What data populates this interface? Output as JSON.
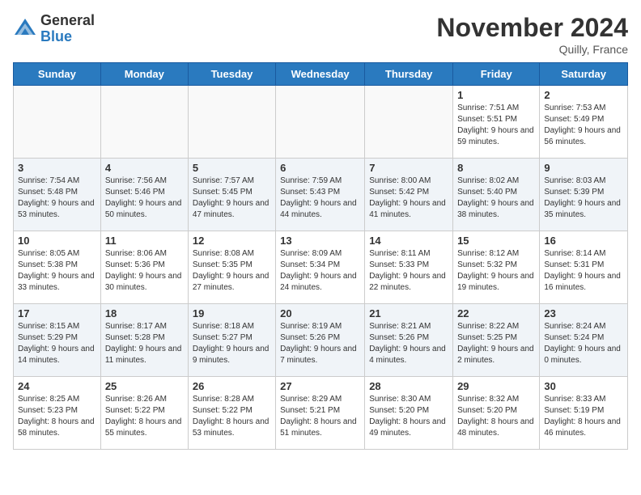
{
  "logo": {
    "general": "General",
    "blue": "Blue"
  },
  "header": {
    "month": "November 2024",
    "location": "Quilly, France"
  },
  "weekdays": [
    "Sunday",
    "Monday",
    "Tuesday",
    "Wednesday",
    "Thursday",
    "Friday",
    "Saturday"
  ],
  "weeks": [
    [
      {
        "day": null,
        "info": ""
      },
      {
        "day": null,
        "info": ""
      },
      {
        "day": null,
        "info": ""
      },
      {
        "day": null,
        "info": ""
      },
      {
        "day": null,
        "info": ""
      },
      {
        "day": "1",
        "info": "Sunrise: 7:51 AM\nSunset: 5:51 PM\nDaylight: 9 hours and 59 minutes."
      },
      {
        "day": "2",
        "info": "Sunrise: 7:53 AM\nSunset: 5:49 PM\nDaylight: 9 hours and 56 minutes."
      }
    ],
    [
      {
        "day": "3",
        "info": "Sunrise: 7:54 AM\nSunset: 5:48 PM\nDaylight: 9 hours and 53 minutes."
      },
      {
        "day": "4",
        "info": "Sunrise: 7:56 AM\nSunset: 5:46 PM\nDaylight: 9 hours and 50 minutes."
      },
      {
        "day": "5",
        "info": "Sunrise: 7:57 AM\nSunset: 5:45 PM\nDaylight: 9 hours and 47 minutes."
      },
      {
        "day": "6",
        "info": "Sunrise: 7:59 AM\nSunset: 5:43 PM\nDaylight: 9 hours and 44 minutes."
      },
      {
        "day": "7",
        "info": "Sunrise: 8:00 AM\nSunset: 5:42 PM\nDaylight: 9 hours and 41 minutes."
      },
      {
        "day": "8",
        "info": "Sunrise: 8:02 AM\nSunset: 5:40 PM\nDaylight: 9 hours and 38 minutes."
      },
      {
        "day": "9",
        "info": "Sunrise: 8:03 AM\nSunset: 5:39 PM\nDaylight: 9 hours and 35 minutes."
      }
    ],
    [
      {
        "day": "10",
        "info": "Sunrise: 8:05 AM\nSunset: 5:38 PM\nDaylight: 9 hours and 33 minutes."
      },
      {
        "day": "11",
        "info": "Sunrise: 8:06 AM\nSunset: 5:36 PM\nDaylight: 9 hours and 30 minutes."
      },
      {
        "day": "12",
        "info": "Sunrise: 8:08 AM\nSunset: 5:35 PM\nDaylight: 9 hours and 27 minutes."
      },
      {
        "day": "13",
        "info": "Sunrise: 8:09 AM\nSunset: 5:34 PM\nDaylight: 9 hours and 24 minutes."
      },
      {
        "day": "14",
        "info": "Sunrise: 8:11 AM\nSunset: 5:33 PM\nDaylight: 9 hours and 22 minutes."
      },
      {
        "day": "15",
        "info": "Sunrise: 8:12 AM\nSunset: 5:32 PM\nDaylight: 9 hours and 19 minutes."
      },
      {
        "day": "16",
        "info": "Sunrise: 8:14 AM\nSunset: 5:31 PM\nDaylight: 9 hours and 16 minutes."
      }
    ],
    [
      {
        "day": "17",
        "info": "Sunrise: 8:15 AM\nSunset: 5:29 PM\nDaylight: 9 hours and 14 minutes."
      },
      {
        "day": "18",
        "info": "Sunrise: 8:17 AM\nSunset: 5:28 PM\nDaylight: 9 hours and 11 minutes."
      },
      {
        "day": "19",
        "info": "Sunrise: 8:18 AM\nSunset: 5:27 PM\nDaylight: 9 hours and 9 minutes."
      },
      {
        "day": "20",
        "info": "Sunrise: 8:19 AM\nSunset: 5:26 PM\nDaylight: 9 hours and 7 minutes."
      },
      {
        "day": "21",
        "info": "Sunrise: 8:21 AM\nSunset: 5:26 PM\nDaylight: 9 hours and 4 minutes."
      },
      {
        "day": "22",
        "info": "Sunrise: 8:22 AM\nSunset: 5:25 PM\nDaylight: 9 hours and 2 minutes."
      },
      {
        "day": "23",
        "info": "Sunrise: 8:24 AM\nSunset: 5:24 PM\nDaylight: 9 hours and 0 minutes."
      }
    ],
    [
      {
        "day": "24",
        "info": "Sunrise: 8:25 AM\nSunset: 5:23 PM\nDaylight: 8 hours and 58 minutes."
      },
      {
        "day": "25",
        "info": "Sunrise: 8:26 AM\nSunset: 5:22 PM\nDaylight: 8 hours and 55 minutes."
      },
      {
        "day": "26",
        "info": "Sunrise: 8:28 AM\nSunset: 5:22 PM\nDaylight: 8 hours and 53 minutes."
      },
      {
        "day": "27",
        "info": "Sunrise: 8:29 AM\nSunset: 5:21 PM\nDaylight: 8 hours and 51 minutes."
      },
      {
        "day": "28",
        "info": "Sunrise: 8:30 AM\nSunset: 5:20 PM\nDaylight: 8 hours and 49 minutes."
      },
      {
        "day": "29",
        "info": "Sunrise: 8:32 AM\nSunset: 5:20 PM\nDaylight: 8 hours and 48 minutes."
      },
      {
        "day": "30",
        "info": "Sunrise: 8:33 AM\nSunset: 5:19 PM\nDaylight: 8 hours and 46 minutes."
      }
    ]
  ]
}
